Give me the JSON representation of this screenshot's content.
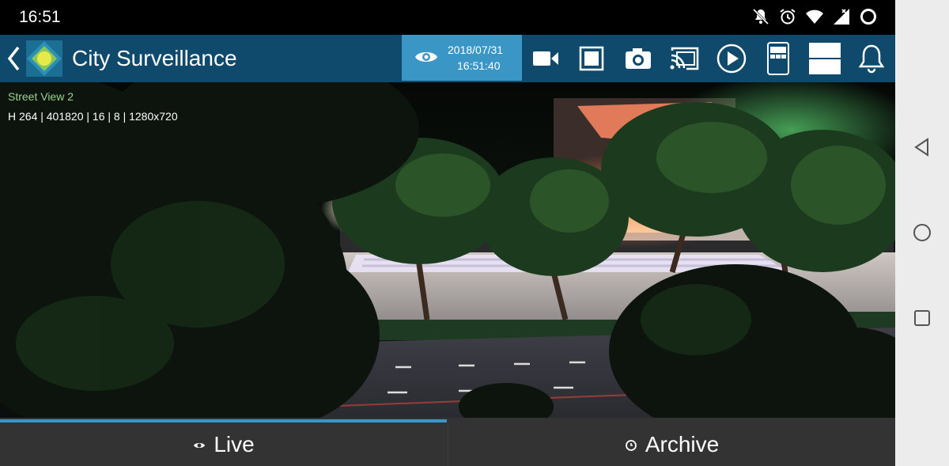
{
  "status_bar": {
    "time": "16:51",
    "icons": [
      "bell-off-icon",
      "alarm-icon",
      "wifi-icon",
      "signal-icon",
      "battery-ring-icon"
    ]
  },
  "app_bar": {
    "back_icon": "chevron-left-icon",
    "logo_icon": "diamond-logo-icon",
    "title": "City Surveillance",
    "datetime": {
      "icon": "eye-icon",
      "date": "2018/07/31",
      "time": "16:51:40"
    },
    "toolbar_icons": [
      "video-camera-icon",
      "stop-icon",
      "camera-icon",
      "cast-icon",
      "play-icon",
      "grid-layout-icon",
      "split-view-icon",
      "notification-bell-icon"
    ]
  },
  "video": {
    "camera_name": "Street View 2",
    "stream_info": "H 264 | 401820 | 16 | 8 | 1280x720"
  },
  "tabs": {
    "live": "Live",
    "archive": "Archive",
    "active": "live"
  },
  "nav_bar": {
    "icons": [
      "back-triangle-icon",
      "home-circle-icon",
      "recents-square-icon"
    ]
  },
  "colors": {
    "app_bar": "#0f4a6d",
    "accent": "#3a96c4",
    "tab_bar": "#333333",
    "camera_name": "#9bd28a"
  }
}
